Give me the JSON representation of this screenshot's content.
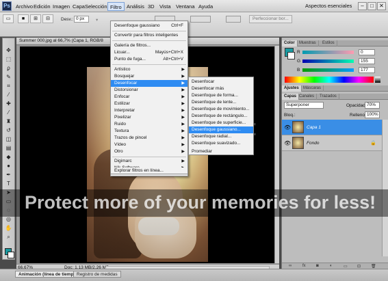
{
  "menubar": {
    "logo": "Ps",
    "items": [
      "Archivo",
      "Edición",
      "Imagen",
      "Capa",
      "Selección",
      "Filtro",
      "Análisis",
      "3D",
      "Vista",
      "Ventana",
      "Ayuda"
    ],
    "zoom": "66,7",
    "workspace": "Aspectos esenciales",
    "win_buttons": [
      "–",
      "□",
      "✕"
    ]
  },
  "options": {
    "desv_label": "Desv.:",
    "desv_value": "0 px",
    "estilo_label": "Normal",
    "refine_button": "Perfeccionar bor..."
  },
  "document": {
    "title": "Summer 000.jpg al 66,7% (Capa 1, RGB/8",
    "status_zoom": "66,67%",
    "status_size": "Doc: 1,13 MB/2,26 MB"
  },
  "watermark": {
    "logo_text": "photobucket",
    "text": "Protect more of your memories for less!"
  },
  "filter_menu": {
    "items": [
      {
        "label": "Desenfoque gaussiano",
        "shortcut": "Ctrl+F"
      },
      {
        "label": "Convertir para filtros inteligentes"
      },
      {
        "label": "Galería de filtros..."
      },
      {
        "label": "Licuar...",
        "shortcut": "Mayús+Ctrl+X"
      },
      {
        "label": "Punto de fuga...",
        "shortcut": "Alt+Ctrl+V"
      },
      {
        "label": "Artístico"
      },
      {
        "label": "Bosquejar"
      },
      {
        "label": "Desenfocar"
      },
      {
        "label": "Distorsionar"
      },
      {
        "label": "Enfocar"
      },
      {
        "label": "Estilizar"
      },
      {
        "label": "Interpretar"
      },
      {
        "label": "Pixelizar"
      },
      {
        "label": "Ruido"
      },
      {
        "label": "Textura"
      },
      {
        "label": "Trazos de pincel"
      },
      {
        "label": "Vídeo"
      },
      {
        "label": "Otro"
      },
      {
        "label": "Digimarc"
      },
      {
        "label": "Nik Software"
      },
      {
        "label": "Explorar filtros en línea..."
      }
    ]
  },
  "blur_submenu": {
    "items": [
      "Desenfocar",
      "Desenfocar más",
      "Desenfoque de forma...",
      "Desenfoque de lente...",
      "Desenfoque de movimiento...",
      "Desenfoque de rectángulo...",
      "Desenfoque de superficie...",
      "Desenfoque gaussiano...",
      "Desenfoque radial...",
      "Desenfoque suavizado...",
      "Promediar"
    ]
  },
  "color_panel": {
    "tabs": [
      "Color",
      "Muestras",
      "Estilos"
    ],
    "r_label": "R",
    "g_label": "G",
    "b_label": "B",
    "r_value": "0",
    "g_value": "155",
    "b_value": "177",
    "fg_color": "#1a9aa0"
  },
  "adjust_panel": {
    "tabs": [
      "Ajustes",
      "Máscaras"
    ]
  },
  "layers_panel": {
    "tabs": [
      "Capas",
      "Canales",
      "Trazados"
    ],
    "blend_mode": "Superponer",
    "opacity_label": "Opacidad:",
    "opacity_value": "70%",
    "lock_label": "Bloq.:",
    "fill_label": "Relleno:",
    "fill_value": "100%",
    "layers": [
      {
        "name": "Capa 1",
        "selected": true
      },
      {
        "name": "Fondo",
        "selected": false
      }
    ]
  },
  "bottom_tabs": [
    "Animación (línea de tiempo)",
    "Registro de medidas"
  ],
  "icons": {
    "accent": "#2f8cf2",
    "selection": "#3a8ee6"
  }
}
